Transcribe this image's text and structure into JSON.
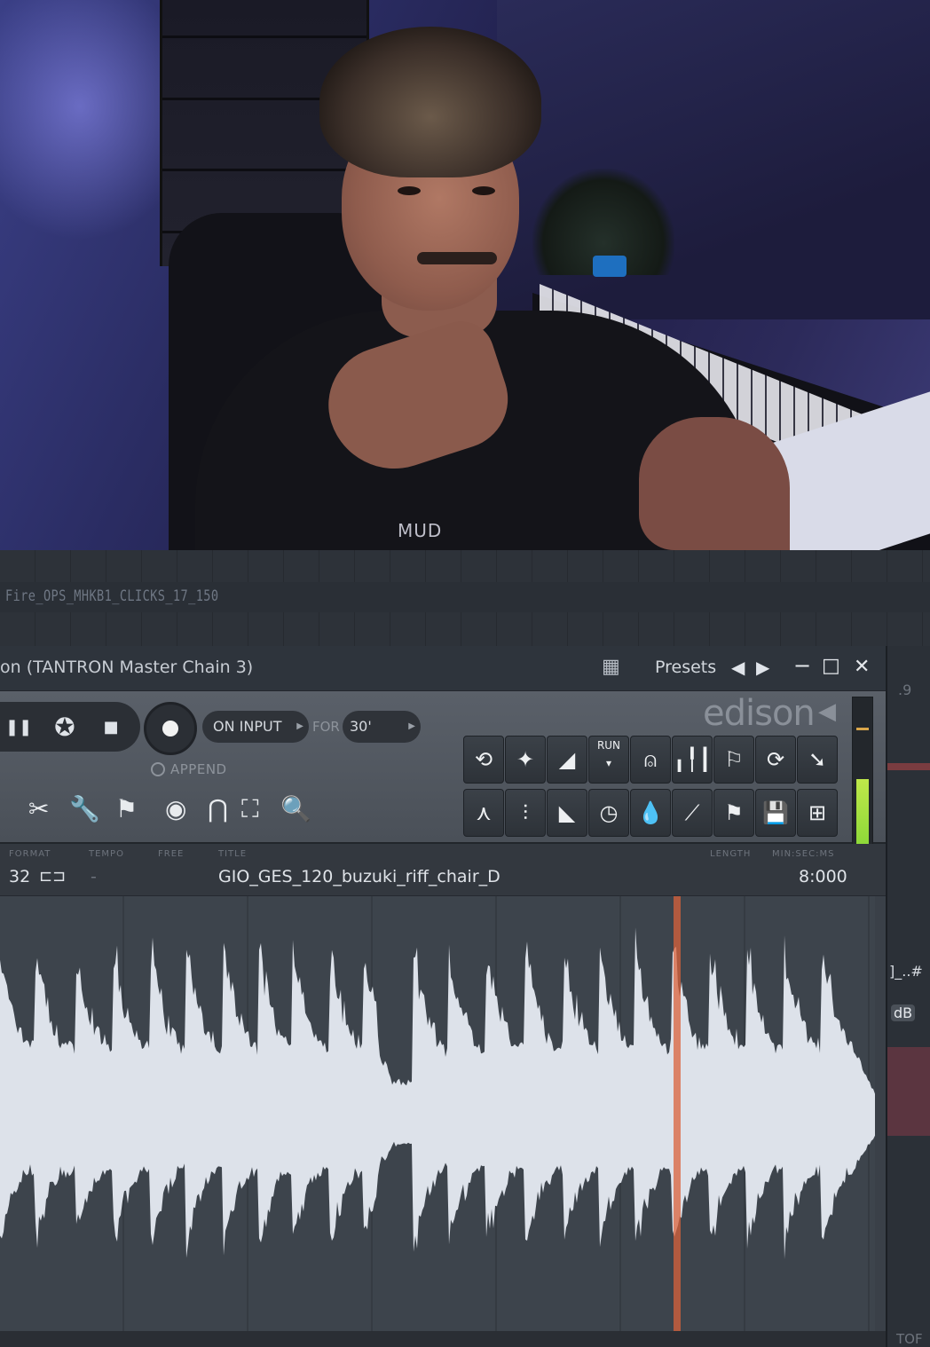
{
  "track": {
    "name": "Fire_OPS_MHKB1_CLICKS_17_150"
  },
  "window": {
    "title": "on (TANTRON Master Chain 3)",
    "presets_label": "Presets",
    "minimize": "−",
    "maximize": "□",
    "close": "✕"
  },
  "toolbar": {
    "record_mode": "ON INPUT",
    "for_label": "FOR",
    "for_value": "30'",
    "append_label": "APPEND",
    "logo": "edison"
  },
  "info": {
    "format_label": "FORMAT",
    "format_value": "32",
    "tempo_label": "TEMPO",
    "tempo_value": "-",
    "free_label": "FREE",
    "title_label": "TITLE",
    "title_value": "GIO_GES_120_buzuki_riff_chair_D",
    "length_label": "LENGTH",
    "time_label": "MIN:SEC:MS",
    "time_value": "8:000"
  },
  "shirt_text": "MUD",
  "side_labels": {
    "a": ".9",
    "b": "]_..#",
    "c": "dB",
    "d": "TOF"
  },
  "colors": {
    "accent": "#d9623b",
    "waveform": "#dde2ea",
    "meter": "#9ad83a"
  }
}
